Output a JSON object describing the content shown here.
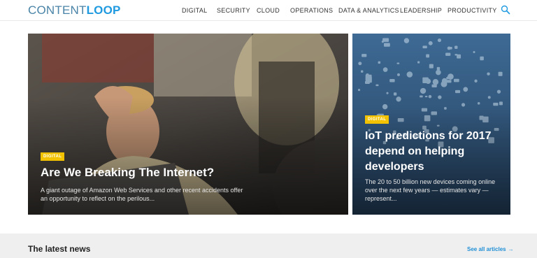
{
  "header": {
    "logo_light": "CONTENT",
    "logo_bold": "LOOP",
    "nav": [
      {
        "label": "DIGITAL",
        "name": "nav-digital"
      },
      {
        "label": "SECURITY",
        "name": "nav-security"
      },
      {
        "label": "CLOUD",
        "name": "nav-cloud"
      },
      {
        "label": "OPERATIONS",
        "name": "nav-operations"
      },
      {
        "label": "DATA & ANALYTICS",
        "name": "nav-data-analytics"
      },
      {
        "label": "LEADERSHIP",
        "name": "nav-leadership"
      },
      {
        "label": "PRODUCTIVITY",
        "name": "nav-productivity"
      }
    ],
    "search_icon": "search-icon"
  },
  "featured": {
    "badge": "DIGITAL",
    "title": "Are We Breaking The Internet?",
    "excerpt": "A giant outage of Amazon Web Services and other recent accidents offer an opportunity to reflect on the perilous..."
  },
  "side": {
    "badge": "DIGITAL",
    "title": "IoT predictions for 2017 depend on helping developers",
    "excerpt": "The 20 to 50 billion new devices coming online over the next few years — estimates vary — represent..."
  },
  "latest": {
    "title": "The latest news",
    "see_all": "See all articles",
    "arrow": "→"
  },
  "colors": {
    "accent": "#1f9ae0",
    "badge": "#f2c200",
    "iot_bg": "#2e5277"
  }
}
